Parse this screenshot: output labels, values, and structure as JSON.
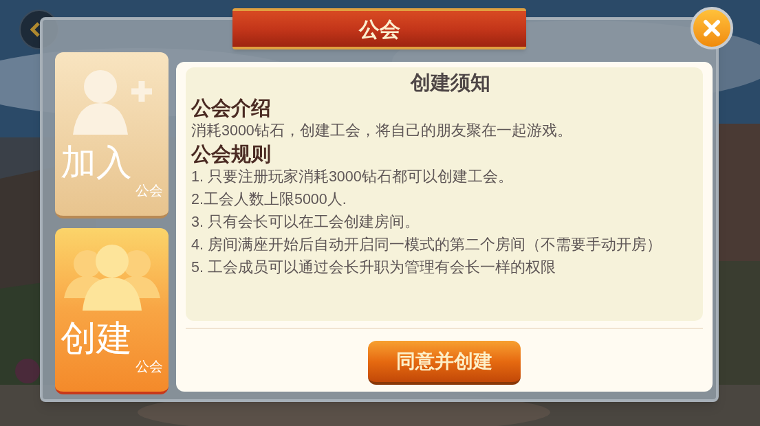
{
  "dialog": {
    "title": "公会"
  },
  "tabs": [
    {
      "kind": "join",
      "label": "加入",
      "sublabel": "公会",
      "selected": false
    },
    {
      "kind": "create",
      "label": "创建",
      "sublabel": "公会",
      "selected": true
    }
  ],
  "notice": {
    "heading": "创建须知",
    "sections": [
      {
        "heading": "公会介绍",
        "lines": [
          "消耗3000钻石，创建工会，将自己的朋友聚在一起游戏。"
        ]
      },
      {
        "heading": "公会规则",
        "lines": [
          "1. 只要注册玩家消耗3000钻石都可以创建工会。",
          "2.工会人数上限5000人.",
          "3. 只有会长可以在工会创建房间。",
          "4. 房间满座开始后自动开启同一模式的第二个房间（不需要手动开房）",
          "5. 工会成员可以通过会长升职为管理有会长一样的权限"
        ]
      }
    ]
  },
  "confirm_button": {
    "label": "同意并创建"
  }
}
